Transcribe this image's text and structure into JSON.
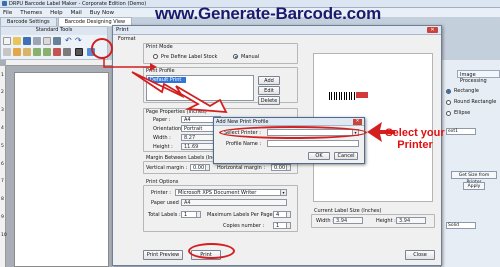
{
  "app": {
    "title": "DRPU Barcode Label Maker - Corporate Edition (Demo)",
    "menu": [
      "File",
      "Themes",
      "Help",
      "Mail",
      "Buy Now"
    ],
    "tabs": [
      "Barcode Settings",
      "Barcode Designing View"
    ],
    "website": "www.Generate-Barcode.com",
    "toolbar_label": "Standard Tools",
    "ruler_numbers": [
      "1",
      "2",
      "3",
      "4",
      "5",
      "6",
      "7",
      "8",
      "9",
      "10"
    ]
  },
  "right_panel": {
    "tab": "Image Processing",
    "shapes": [
      "Rectangle",
      "Round Rectangle",
      "Ellipse"
    ],
    "size_button": "Get Size from Printer",
    "apply": "Apply",
    "fields": [
      "ext1",
      "Solid"
    ]
  },
  "print_dialog": {
    "title": "Print",
    "format_label": "Format",
    "print_mode_label": "Print Mode",
    "mode_options": [
      "Pre Define Label Stock",
      "Manual"
    ],
    "mode_selected": 1,
    "profile_label": "Print Profile",
    "profile_selected": "Default Print Profile",
    "profile_buttons": [
      "Add",
      "Edit",
      "Delete"
    ],
    "page_props_label": "Page Properties (Inches)",
    "page_props": [
      {
        "label": "Paper :",
        "value": "A4"
      },
      {
        "label": "Orientation :",
        "value": "Portrait"
      },
      {
        "label": "Width :",
        "value": "8.27"
      },
      {
        "label": "Height :",
        "value": "11.69"
      }
    ],
    "margin_label": "Margin Between Labels (Inches)",
    "vertical_margin_label": "Vertical margin :",
    "vertical_margin": "0.00",
    "horizontal_margin_label": "Horizontal margin :",
    "horizontal_margin": "0.00",
    "options_label": "Print Options",
    "printer_label": "Printer :",
    "printer_value": "Microsoft XPS Document Writer",
    "paper_used_label": "Paper used :",
    "paper_used_value": "A4",
    "total_labels_label": "Total Labels :",
    "total_labels_value": "1",
    "max_labels_label": "Maximum Labels Per Page :",
    "max_labels_value": "4",
    "copies_label": "Copies number :",
    "copies_value": "1",
    "label_size_label": "Current Label Size (Inches)",
    "width_label": "Width :",
    "width_value": "3.94",
    "height_label": "Height :",
    "height_value": "3.94",
    "buttons": {
      "preview": "Print Preview",
      "print": "Print",
      "close": "Close"
    }
  },
  "add_profile": {
    "title": "Add New Print Profile",
    "select_printer_label": "Select Printer :",
    "select_printer_value": "",
    "profile_name_label": "Profile Name :",
    "profile_name_value": "",
    "ok": "OK",
    "cancel": "Cancel"
  },
  "annotation": {
    "callout": "Select your Printer",
    "color": "#e01010"
  }
}
